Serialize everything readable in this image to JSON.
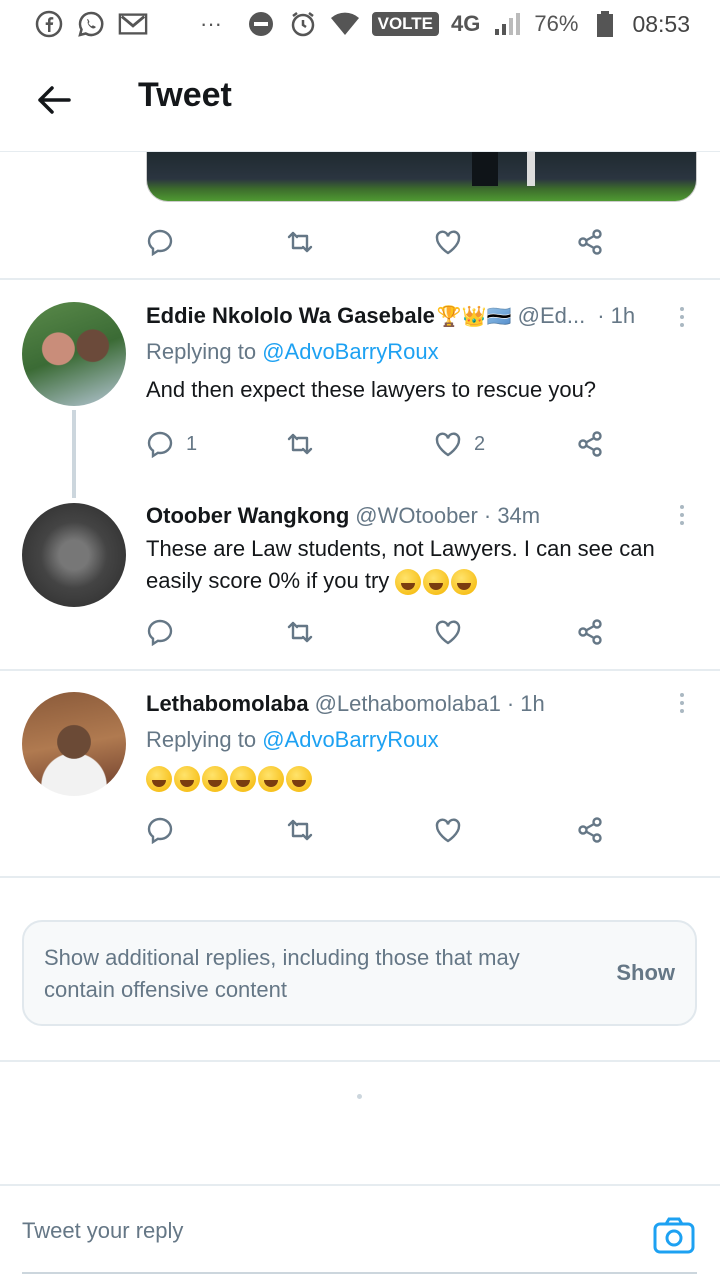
{
  "status_bar": {
    "volte": "VOLTE",
    "network": "4G",
    "battery": "76%",
    "time": "08:53",
    "dots": "···"
  },
  "header": {
    "title": "Tweet"
  },
  "replies": [
    {
      "name": "Eddie Nkololo Wa Gasebale",
      "name_emoji": "🏆👑🇧🇼",
      "handle": "@Ed...",
      "time": "· 1h",
      "replying_prefix": "Replying to",
      "replying_to": "@AdvoBarryRoux",
      "text": "And then expect these lawyers to rescue you?",
      "reply_count": "1",
      "like_count": "2"
    },
    {
      "name": "Otoober Wangkong",
      "handle": "@WOtoober",
      "time": "· 34m",
      "text": "These are Law students, not Lawyers. I can see can easily score 0% if you try",
      "emoji_count": 3
    },
    {
      "name": "Lethabomolaba",
      "handle": "@Lethabomolaba1",
      "time": "· 1h",
      "replying_prefix": "Replying to",
      "replying_to": "@AdvoBarryRoux",
      "emoji_count": 6
    }
  ],
  "show_more": {
    "text": "Show additional replies, including those that may contain offensive content",
    "button": "Show"
  },
  "reply_bar": {
    "placeholder": "Tweet your reply"
  },
  "colors": {
    "accent": "#1da1f2",
    "muted": "#657786"
  }
}
